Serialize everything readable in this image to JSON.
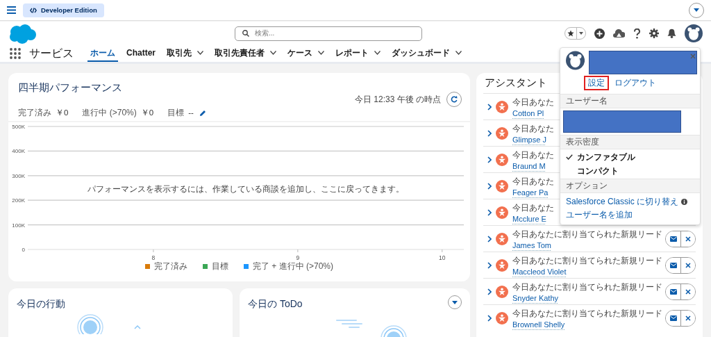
{
  "top_bar": {
    "edition_badge": "Developer Edition"
  },
  "header": {
    "search": {
      "placeholder": "検索..."
    }
  },
  "nav": {
    "app_name": "サービス",
    "tabs": [
      {
        "label": "ホーム",
        "selected": true,
        "has_menu": false
      },
      {
        "label": "Chatter",
        "selected": false,
        "has_menu": false
      },
      {
        "label": "取引先",
        "selected": false,
        "has_menu": true
      },
      {
        "label": "取引先責任者",
        "selected": false,
        "has_menu": true
      },
      {
        "label": "ケース",
        "selected": false,
        "has_menu": true
      },
      {
        "label": "レポート",
        "selected": false,
        "has_menu": true
      },
      {
        "label": "ダッシュボード",
        "selected": false,
        "has_menu": true
      }
    ]
  },
  "performance": {
    "title": "四半期パフォーマンス",
    "timestamp": "今日 12:33 午後 の時点",
    "stats": [
      {
        "label": "完了済み",
        "value": "￥0",
        "editable": false
      },
      {
        "label": "進行中 (>70%)",
        "value": "￥0",
        "editable": false
      },
      {
        "label": "目標",
        "value": "--",
        "editable": true
      }
    ],
    "empty_message": "パフォーマンスを表示するには、作業している商談を追加し、ここに戻ってきます。",
    "chart_data": {
      "type": "bar",
      "grid": true,
      "categories": [
        "8",
        "9",
        "10"
      ],
      "ylim": [
        0,
        500000
      ],
      "yticks": [
        {
          "value": 0,
          "label": "0"
        },
        {
          "value": 100000,
          "label": "100K"
        },
        {
          "value": 200000,
          "label": "200K"
        },
        {
          "value": 300000,
          "label": "300K"
        },
        {
          "value": 400000,
          "label": "400K"
        },
        {
          "value": 500000,
          "label": "500K"
        }
      ],
      "series": [
        {
          "name": "完了済み",
          "color": "#d97b0a",
          "values": [
            null,
            null,
            null
          ]
        },
        {
          "name": "目標",
          "color": "#3ba755",
          "values": [
            null,
            null,
            null
          ]
        },
        {
          "name": "完了 + 進行中 (>70%)",
          "color": "#1b96ff",
          "values": [
            null,
            null,
            null
          ]
        }
      ]
    }
  },
  "activities": {
    "title": "今日の行動"
  },
  "todo": {
    "title": "今日の ToDo"
  },
  "assistant": {
    "title": "アシスタント",
    "items": [
      {
        "label": "今日あなた",
        "name": "Cotton Pl",
        "actions": false
      },
      {
        "label": "今日あなた",
        "name": "Glimpse J",
        "actions": false
      },
      {
        "label": "今日あなた",
        "name": "Braund M",
        "actions": false
      },
      {
        "label": "今日あなた",
        "name": "Feager Pa",
        "actions": false
      },
      {
        "label": "今日あなた",
        "name": "Mcclure E",
        "actions": false
      },
      {
        "label": "今日あなたに割り当てられた新規リード",
        "name": "James Tom",
        "actions": true
      },
      {
        "label": "今日あなたに割り当てられた新規リード",
        "name": "Maccleod Violet",
        "actions": true
      },
      {
        "label": "今日あなたに割り当てられた新規リード",
        "name": "Snyder Kathy",
        "actions": true
      },
      {
        "label": "今日あなたに割り当てられた新規リード",
        "name": "Brownell Shelly",
        "actions": true
      }
    ]
  },
  "user_menu": {
    "links": [
      {
        "label": "設定",
        "highlighted": true
      },
      {
        "label": "ログアウト",
        "highlighted": false
      }
    ],
    "username_heading": "ユーザー名",
    "density": {
      "heading": "表示密度",
      "options": [
        {
          "label": "カンファタブル",
          "selected": true
        },
        {
          "label": "コンパクト",
          "selected": false
        }
      ]
    },
    "options": {
      "heading": "オプション",
      "links": [
        {
          "label": "Salesforce Classic に切り替え",
          "info": true
        },
        {
          "label": "ユーザー名を追加",
          "info": false
        }
      ]
    }
  }
}
